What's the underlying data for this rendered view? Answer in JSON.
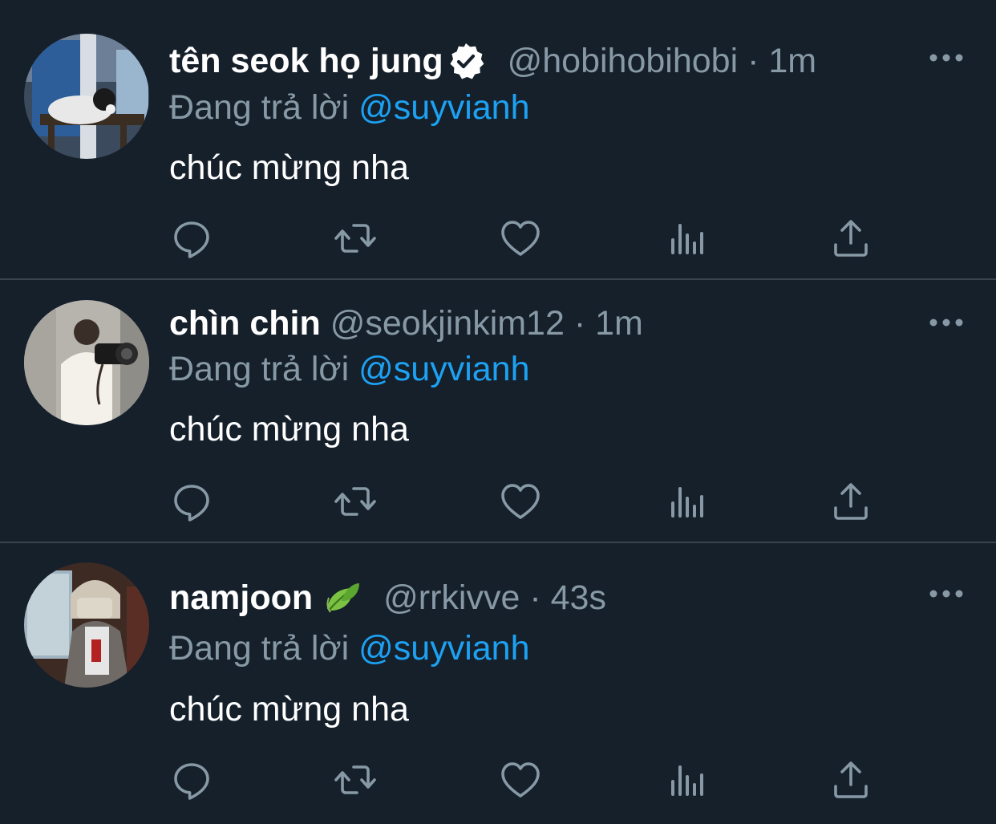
{
  "theme": {
    "background": "#15202b",
    "divider": "#38444d",
    "secondary_text": "#8899a6",
    "accent": "#1da1f2",
    "primary_text": "#ffffff"
  },
  "tweets": [
    {
      "display_name": "tên seok họ jung",
      "badge_icon": "verified-badge-icon",
      "handle": "@hobihobihobi",
      "separator": "·",
      "time": "1m",
      "reply_prefix": "Đang trả lời",
      "reply_to": "@suyvianh",
      "text": "chúc mừng nha",
      "actions": [
        "reply-icon",
        "retweet-icon",
        "like-icon",
        "stats-icon",
        "share-icon"
      ],
      "more_icon": "more-options-icon"
    },
    {
      "display_name": "chìn chin",
      "handle": "@seokjinkim12",
      "separator": "·",
      "time": "1m",
      "reply_prefix": "Đang trả lời",
      "reply_to": "@suyvianh",
      "text": "chúc mừng nha",
      "actions": [
        "reply-icon",
        "retweet-icon",
        "like-icon",
        "stats-icon",
        "share-icon"
      ],
      "more_icon": "more-options-icon"
    },
    {
      "display_name": "namjoon",
      "badge_icon": "leaf-emoji-icon",
      "handle": "@rrkivve",
      "separator": "·",
      "time": "43s",
      "reply_prefix": "Đang trả lời",
      "reply_to": "@suyvianh",
      "text": "chúc mừng nha",
      "actions": [
        "reply-icon",
        "retweet-icon",
        "like-icon",
        "stats-icon",
        "share-icon"
      ],
      "more_icon": "more-options-icon"
    }
  ]
}
